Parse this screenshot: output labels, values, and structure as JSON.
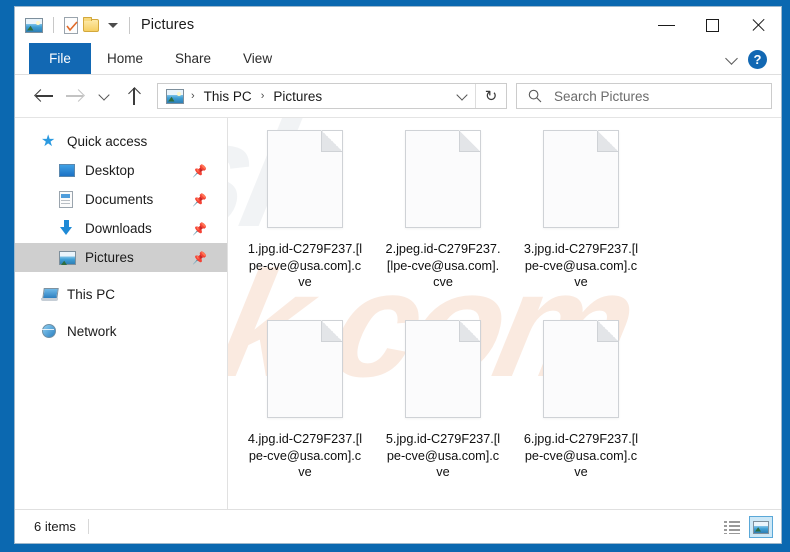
{
  "window": {
    "title": "Pictures",
    "frame_color": "#0b68b0",
    "accent_color": "#1268b3",
    "controls": {
      "minimize": "Minimize",
      "maximize": "Maximize",
      "close": "Close"
    }
  },
  "quick_access_toolbar": {
    "folder_icon": "pictures-folder-icon",
    "properties_label": "Properties",
    "new_folder_label": "New folder",
    "customize_label": "Customize Quick Access Toolbar"
  },
  "ribbon": {
    "tabs": [
      {
        "label": "File",
        "selected": true
      },
      {
        "label": "Home",
        "selected": false
      },
      {
        "label": "Share",
        "selected": false
      },
      {
        "label": "View",
        "selected": false
      }
    ],
    "expand_label": "Expand the Ribbon",
    "help_label": "?"
  },
  "navigation": {
    "back_label": "Back",
    "forward_label": "Forward",
    "recent_label": "Recent locations",
    "up_label": "Up",
    "breadcrumb": {
      "icon": "pictures-folder-icon",
      "separator": "›",
      "items": [
        "This PC",
        "Pictures"
      ]
    },
    "history_caret_label": "Previous locations",
    "refresh_label": "Refresh",
    "refresh_glyph": "↻"
  },
  "search": {
    "placeholder": "Search Pictures",
    "value": "",
    "icon": "search-icon"
  },
  "sidebar": {
    "items": [
      {
        "label": "Quick access",
        "icon": "star-icon",
        "level": "root",
        "pinned": false,
        "selected": false
      },
      {
        "label": "Desktop",
        "icon": "desktop-icon",
        "level": "child",
        "pinned": true,
        "selected": false
      },
      {
        "label": "Documents",
        "icon": "documents-icon",
        "level": "child",
        "pinned": true,
        "selected": false
      },
      {
        "label": "Downloads",
        "icon": "downloads-icon",
        "level": "child",
        "pinned": true,
        "selected": false
      },
      {
        "label": "Pictures",
        "icon": "pictures-icon",
        "level": "child",
        "pinned": true,
        "selected": true
      },
      {
        "label": "This PC",
        "icon": "this-pc-icon",
        "level": "root",
        "pinned": false,
        "selected": false
      },
      {
        "label": "Network",
        "icon": "network-icon",
        "level": "root",
        "pinned": false,
        "selected": false
      }
    ],
    "pin_glyph": "📌"
  },
  "content": {
    "watermark_text": "risk.com",
    "watermark_text2": "pcrisk",
    "files": [
      {
        "name": "1.jpg.id-C279F237.[lpe-cve@usa.com].cve",
        "icon": "blank-document-icon"
      },
      {
        "name": "2.jpeg.id-C279F237.[lpe-cve@usa.com].cve",
        "icon": "blank-document-icon"
      },
      {
        "name": "3.jpg.id-C279F237.[lpe-cve@usa.com].cve",
        "icon": "blank-document-icon"
      },
      {
        "name": "4.jpg.id-C279F237.[lpe-cve@usa.com].cve",
        "icon": "blank-document-icon"
      },
      {
        "name": "5.jpg.id-C279F237.[lpe-cve@usa.com].cve",
        "icon": "blank-document-icon"
      },
      {
        "name": "6.jpg.id-C279F237.[lpe-cve@usa.com].cve",
        "icon": "blank-document-icon"
      }
    ]
  },
  "statusbar": {
    "item_count": "6 items",
    "views": [
      {
        "name": "details-view",
        "label": "Details view",
        "active": false
      },
      {
        "name": "icons-view",
        "label": "Large icons view",
        "active": true
      }
    ]
  }
}
